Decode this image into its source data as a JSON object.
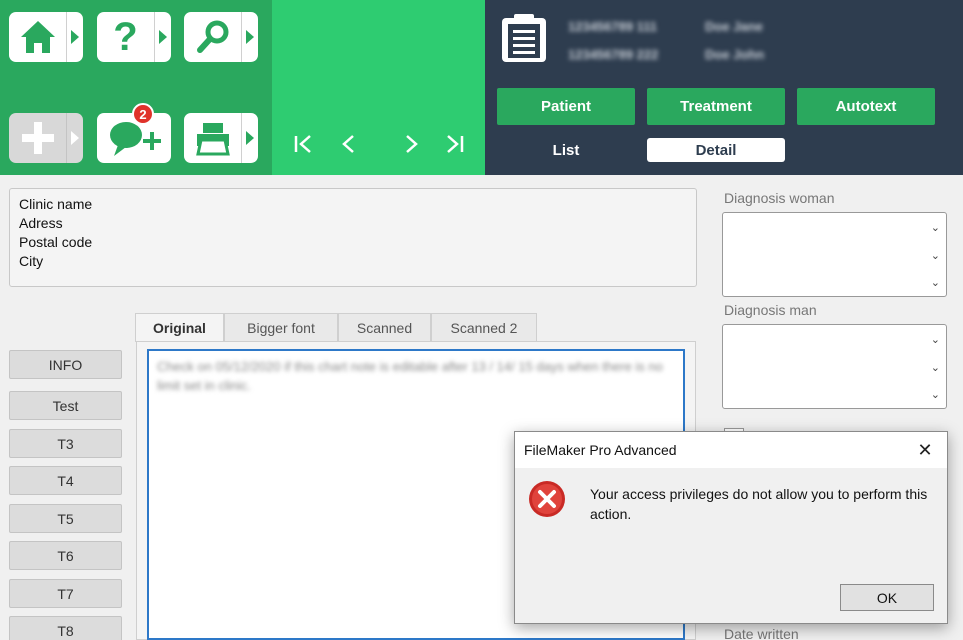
{
  "toolbar": {
    "home": {
      "icon": "home-icon"
    },
    "help": {
      "icon": "question-icon"
    },
    "search": {
      "icon": "search-icon"
    },
    "add": {
      "icon": "plus-icon"
    },
    "message": {
      "icon": "chat-add-icon",
      "badge": "2"
    },
    "print": {
      "icon": "printer-icon"
    }
  },
  "nav": {
    "first": "first-record-icon",
    "prev": "previous-record-icon",
    "next": "next-record-icon",
    "last": "last-record-icon"
  },
  "patients": [
    {
      "id": "123456789 111",
      "name": "Doe Jane"
    },
    {
      "id": "123456789 222",
      "name": "Doe John"
    }
  ],
  "header_buttons": [
    "Patient",
    "Treatment",
    "Autotext"
  ],
  "sub_tabs": [
    "List",
    "Detail"
  ],
  "clinic": {
    "name": "Clinic name",
    "address": "Adress",
    "postal": "Postal code",
    "city": "City"
  },
  "side_buttons": [
    "INFO",
    "Test",
    "T3",
    "T4",
    "T5",
    "T6",
    "T7",
    "T8"
  ],
  "note_tabs": [
    "Original",
    "Bigger font",
    "Scanned",
    "Scanned 2"
  ],
  "note_text": "Check on 05/12/2020 if this chart note is editable after 13 / 14/ 15 days when there is no limit set in clinic.",
  "diagnosis": {
    "woman_label": "Diagnosis woman",
    "man_label": "Diagnosis man",
    "date_label": "Date written"
  },
  "dialog": {
    "title": "FileMaker Pro Advanced",
    "message": "Your access privileges do not allow you to perform this action.",
    "ok": "OK",
    "close": "✕"
  },
  "colors": {
    "green_dark": "#2aa85e",
    "green_light": "#2ecc71",
    "navy": "#2e3d4f",
    "error_red": "#d9312b"
  }
}
